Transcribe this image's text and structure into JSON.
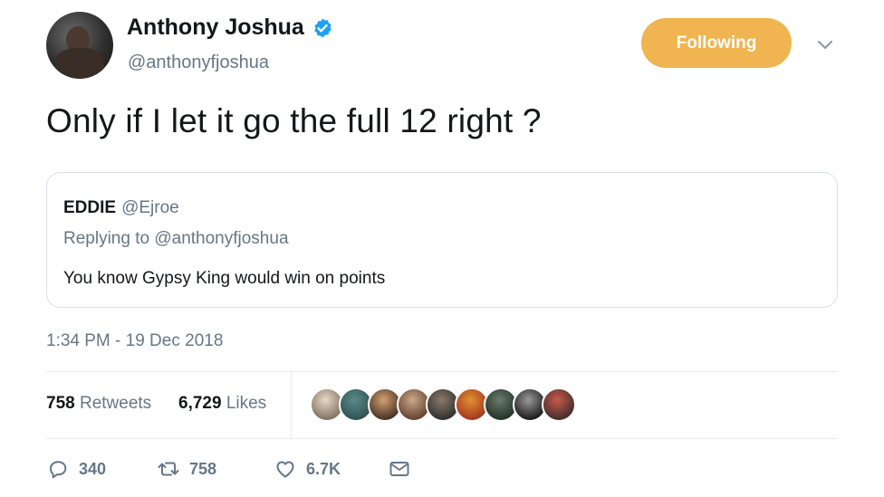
{
  "author": {
    "display_name": "Anthony Joshua",
    "handle": "@anthonyfjoshua",
    "verified": true
  },
  "follow_button": {
    "label": "Following",
    "color": "#f0b450"
  },
  "tweet": {
    "text": "Only if I let it go the full 12 right ?",
    "timestamp": "1:34 PM - 19 Dec 2018"
  },
  "quoted_tweet": {
    "name": "EDDIE",
    "handle": "@Ejroe",
    "replying_label": "Replying to",
    "replying_to": "@anthonyfjoshua",
    "text": "You know Gypsy King would win on points"
  },
  "stats": {
    "retweets_count": "758",
    "retweets_label": "Retweets",
    "likes_count": "6,729",
    "likes_label": "Likes"
  },
  "likers": [
    {
      "colors": [
        "#e8d8c8",
        "#7a6a5a"
      ]
    },
    {
      "colors": [
        "#5a8a8a",
        "#2e4e4e"
      ]
    },
    {
      "colors": [
        "#d4a070",
        "#3a2a20"
      ]
    },
    {
      "colors": [
        "#c9a98a",
        "#5e3a2a"
      ]
    },
    {
      "colors": [
        "#8a7a6a",
        "#2a2a2a"
      ]
    },
    {
      "colors": [
        "#e09030",
        "#a03020"
      ]
    },
    {
      "colors": [
        "#6a7a6a",
        "#1e2e22"
      ]
    },
    {
      "colors": [
        "#9a9a9a",
        "#111111"
      ]
    },
    {
      "colors": [
        "#c85a4a",
        "#3a2a2a"
      ]
    }
  ],
  "actions": {
    "reply_count": "340",
    "retweet_count": "758",
    "like_count": "6.7K"
  },
  "colors": {
    "text_primary": "#14171a",
    "text_secondary": "#657786",
    "verified_blue": "#1da1f2",
    "border": "#e6ecf0"
  }
}
